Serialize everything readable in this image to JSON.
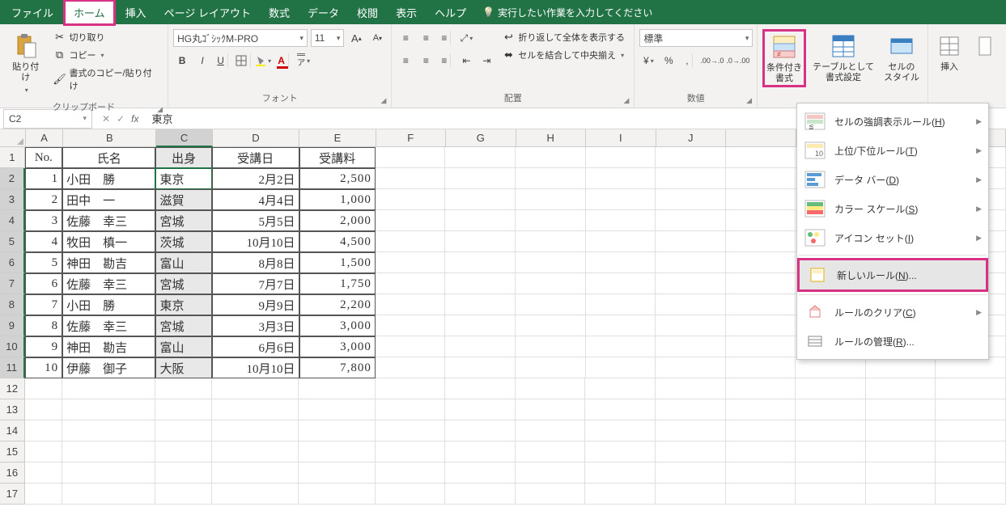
{
  "menubar": {
    "tabs": [
      "ファイル",
      "ホーム",
      "挿入",
      "ページ レイアウト",
      "数式",
      "データ",
      "校閲",
      "表示",
      "ヘルプ"
    ],
    "active": "ホーム",
    "tell_me": "実行したい作業を入力してください"
  },
  "ribbon": {
    "clipboard": {
      "paste": "貼り付け",
      "cut": "切り取り",
      "copy": "コピー",
      "format_painter": "書式のコピー/貼り付け",
      "label": "クリップボード"
    },
    "font": {
      "name": "HG丸ｺﾞｼｯｸM-PRO",
      "size": "11",
      "label": "フォント",
      "bold": "B",
      "italic": "I",
      "underline": "U"
    },
    "alignment": {
      "wrap": "折り返して全体を表示する",
      "merge": "セルを結合して中央揃え",
      "label": "配置"
    },
    "number": {
      "format": "標準",
      "label": "数値"
    },
    "styles": {
      "cond": "条件付き\n書式",
      "table": "テーブルとして\n書式設定",
      "cell": "セルの\nスタイル"
    },
    "cells": {
      "insert": "挿入"
    }
  },
  "formula_bar": {
    "name_box": "C2",
    "value": "東京"
  },
  "grid": {
    "col_widths": {
      "A": 48,
      "B": 120,
      "C": 72,
      "D": 112,
      "E": 98,
      "rest": 90
    },
    "cols": [
      "A",
      "B",
      "C",
      "D",
      "E",
      "F",
      "G",
      "H",
      "I",
      "J"
    ],
    "header": {
      "A": "No.",
      "B": "氏名",
      "C": "出身",
      "D": "受講日",
      "E": "受講料"
    },
    "rows": [
      {
        "A": "1",
        "B": "小田　勝",
        "C": "東京",
        "D": "2月2日",
        "E": "2,500"
      },
      {
        "A": "2",
        "B": "田中　一",
        "C": "滋賀",
        "D": "4月4日",
        "E": "1,000"
      },
      {
        "A": "3",
        "B": "佐藤　幸三",
        "C": "宮城",
        "D": "5月5日",
        "E": "2,000"
      },
      {
        "A": "4",
        "B": "牧田　槙一",
        "C": "茨城",
        "D": "10月10日",
        "E": "4,500"
      },
      {
        "A": "5",
        "B": "神田　勘吉",
        "C": "富山",
        "D": "8月8日",
        "E": "1,500"
      },
      {
        "A": "6",
        "B": "佐藤　幸三",
        "C": "宮城",
        "D": "7月7日",
        "E": "1,750"
      },
      {
        "A": "7",
        "B": "小田　勝",
        "C": "東京",
        "D": "9月9日",
        "E": "2,200"
      },
      {
        "A": "8",
        "B": "佐藤　幸三",
        "C": "宮城",
        "D": "3月3日",
        "E": "3,000"
      },
      {
        "A": "9",
        "B": "神田　勘吉",
        "C": "富山",
        "D": "6月6日",
        "E": "3,000"
      },
      {
        "A": "10",
        "B": "伊藤　御子",
        "C": "大阪",
        "D": "10月10日",
        "E": "7,800"
      }
    ],
    "empty_rows": 6,
    "active_cell": "C2",
    "selected_col": "C"
  },
  "dropdown": {
    "items": [
      {
        "label": "セルの強調表示ルール(",
        "key": "H",
        "suffix": ")",
        "sub": true,
        "ic": "highlight"
      },
      {
        "label": "上位/下位ルール(",
        "key": "T",
        "suffix": ")",
        "sub": true,
        "ic": "toprank"
      },
      {
        "label": "データ バー(",
        "key": "D",
        "suffix": ")",
        "sub": true,
        "ic": "databar"
      },
      {
        "label": "カラー スケール(",
        "key": "S",
        "suffix": ")",
        "sub": true,
        "ic": "colorscale"
      },
      {
        "label": "アイコン セット(",
        "key": "I",
        "suffix": ")",
        "sub": true,
        "ic": "iconset"
      },
      {
        "label": "新しいルール(",
        "key": "N",
        "suffix": ")...",
        "sub": false,
        "ic": "newrule",
        "highlight": true
      },
      {
        "label": "ルールのクリア(",
        "key": "C",
        "suffix": ")",
        "sub": true,
        "ic": "clear"
      },
      {
        "label": "ルールの管理(",
        "key": "R",
        "suffix": ")...",
        "sub": false,
        "ic": "manage"
      }
    ]
  }
}
